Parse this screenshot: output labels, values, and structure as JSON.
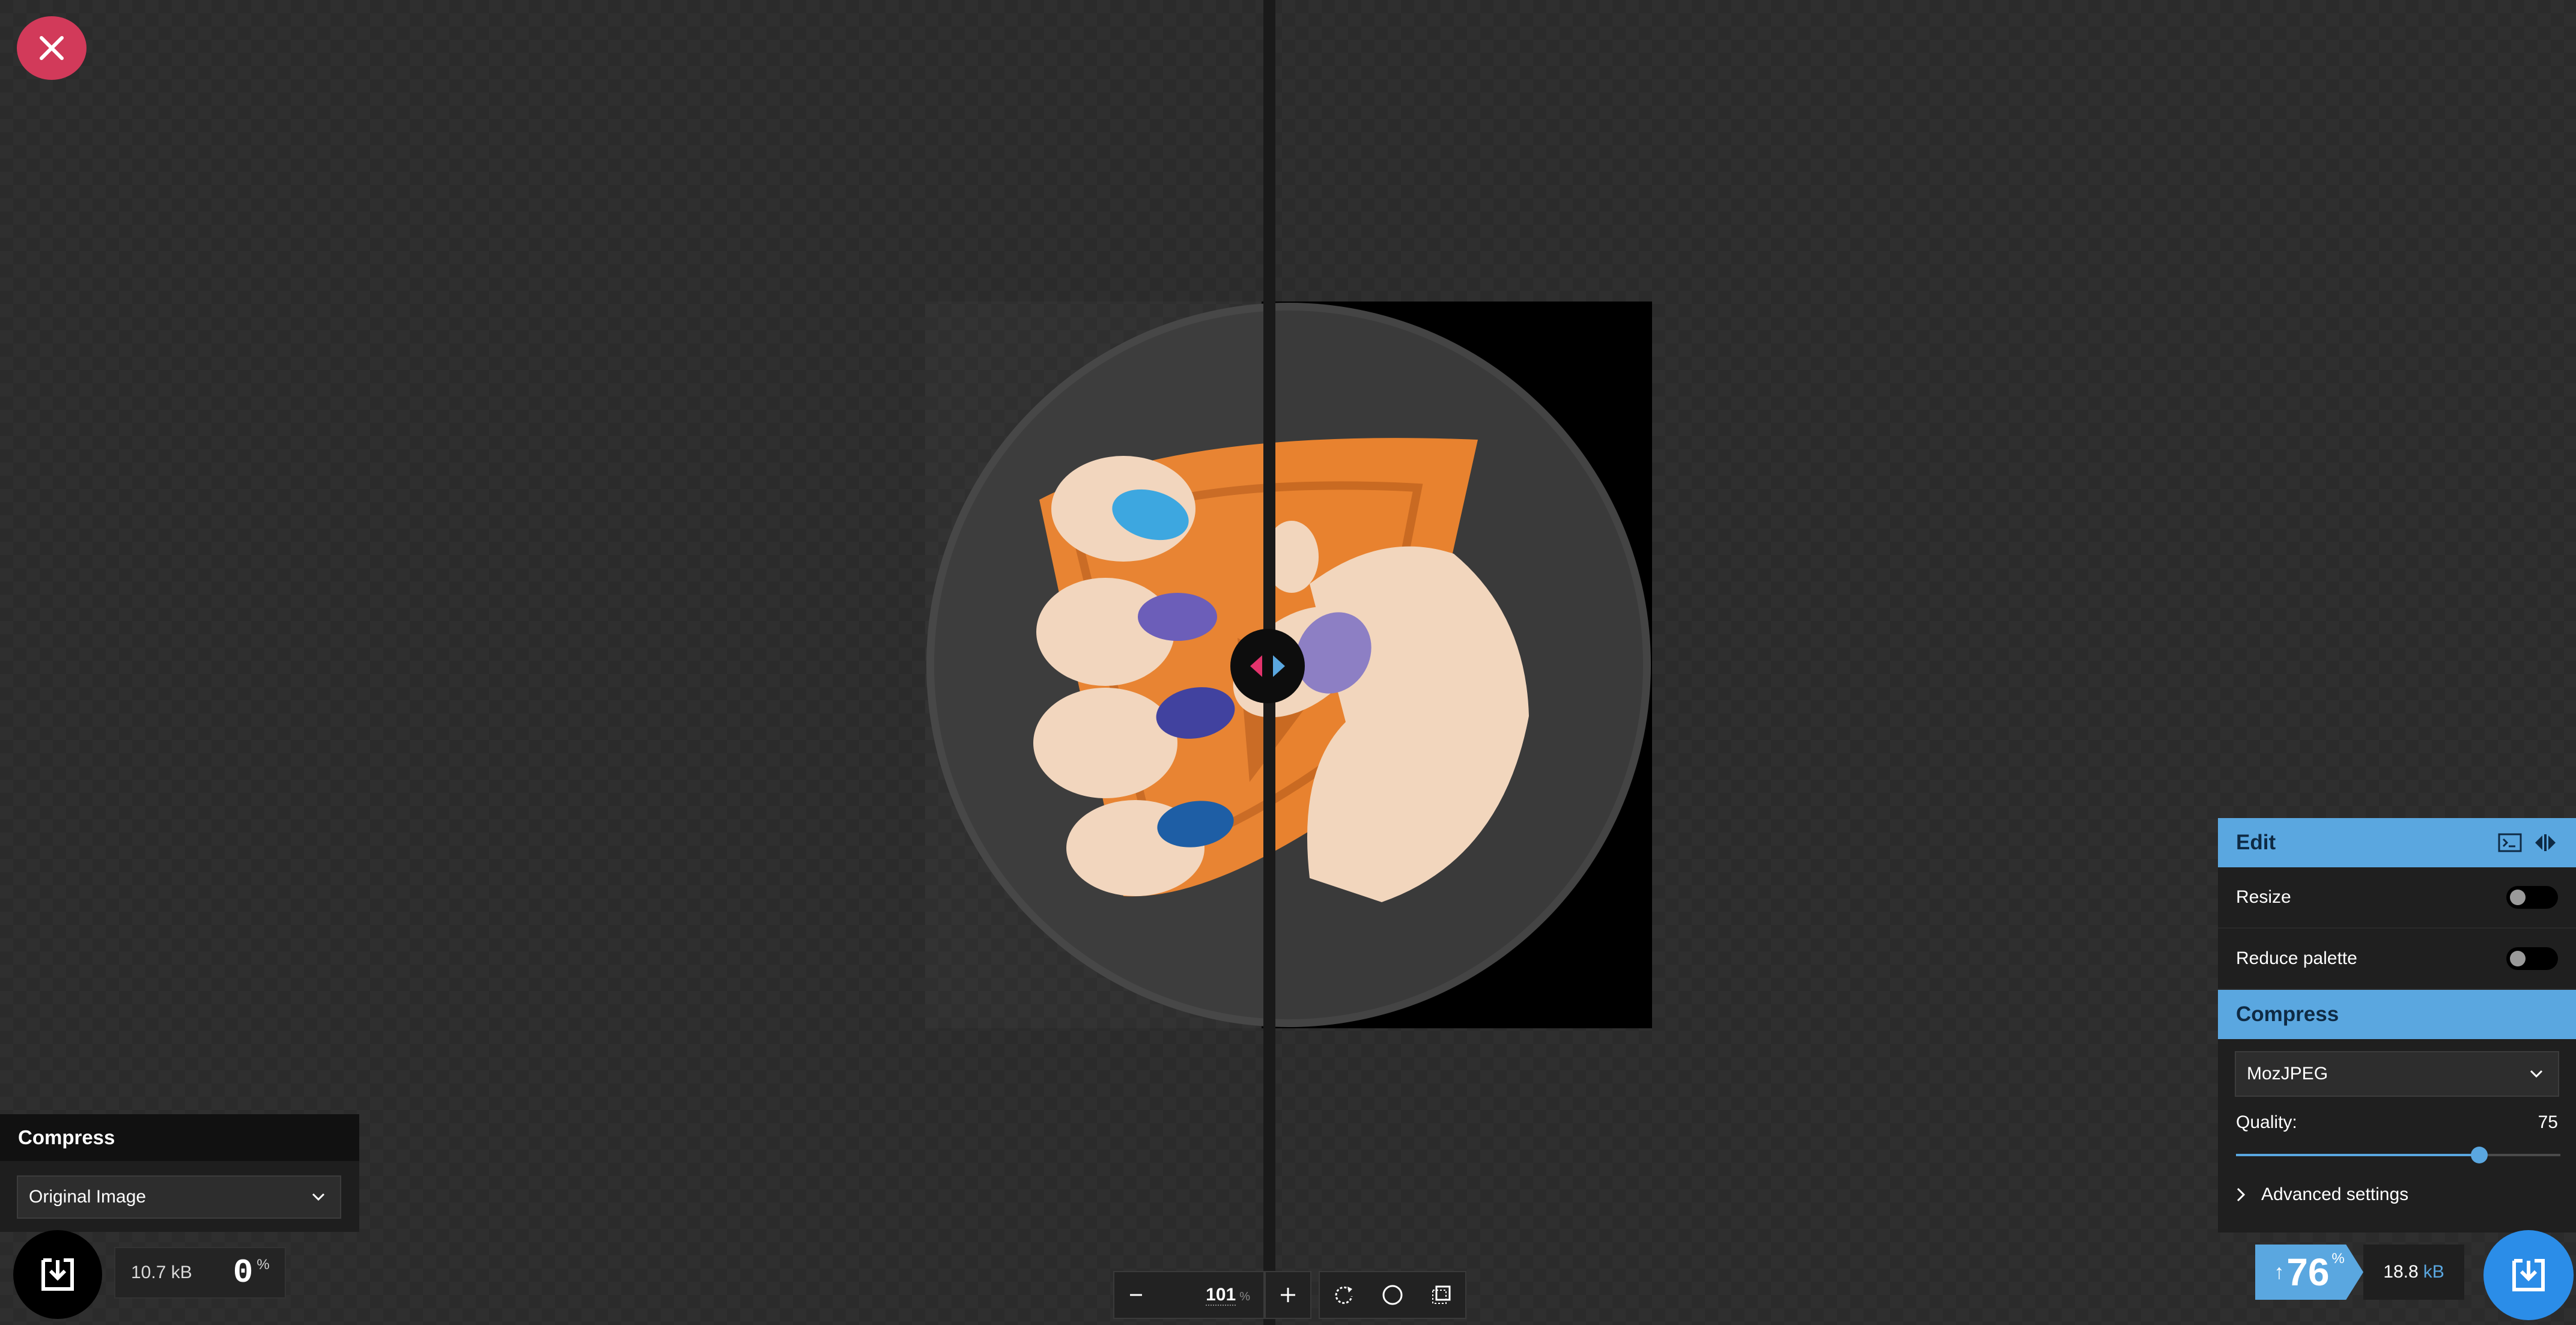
{
  "close": {
    "icon": "close-icon"
  },
  "image": {
    "description_icon": "hand-holding-money-image"
  },
  "split_handle": {
    "icon": "split-arrows-icon",
    "left_color": "#e2336c",
    "right_color": "#5aa7e0"
  },
  "left_panel": {
    "header": "Compress",
    "method": "Original Image",
    "file_size": "10.7 kB",
    "percent": "0",
    "percent_sign": "%"
  },
  "toolbar": {
    "zoom_value": "101",
    "zoom_unit": "%"
  },
  "right_panel": {
    "edit_header": "Edit",
    "resize_label": "Resize",
    "resize_on": false,
    "reduce_palette_label": "Reduce palette",
    "reduce_palette_on": false,
    "compress_header": "Compress",
    "method": "MozJPEG",
    "quality_label": "Quality:",
    "quality_value": "75",
    "quality_level": 0.75,
    "advanced_label": "Advanced settings",
    "savings_arrow": "↑",
    "savings_percent": "76",
    "savings_sign": "%",
    "file_size_value": "18.8",
    "file_size_unit": "kB"
  },
  "colors": {
    "accent": "#5aa7e0",
    "close": "#d23a5a",
    "download_right": "#2b8de8"
  }
}
